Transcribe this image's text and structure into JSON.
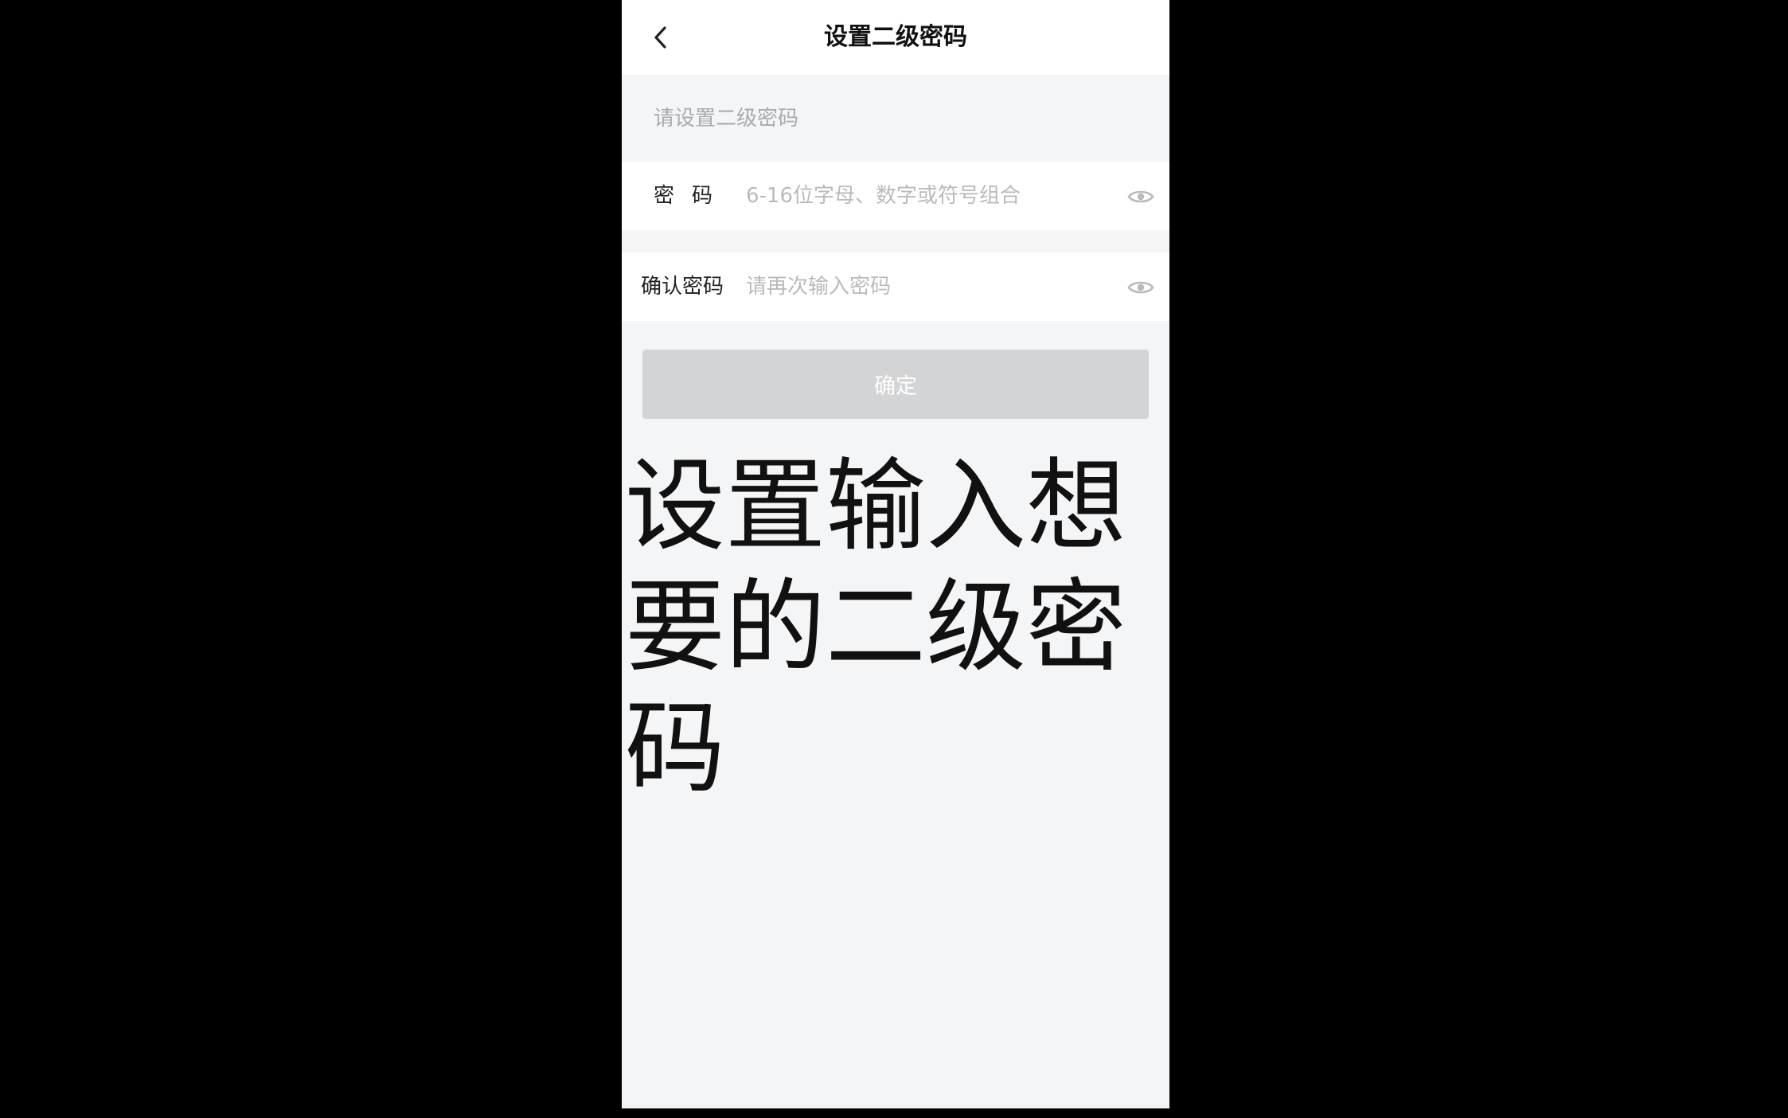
{
  "header": {
    "title": "设置二级密码",
    "back_icon": "chevron-left-icon"
  },
  "form": {
    "section_hint": "请设置二级密码",
    "password": {
      "label": "密码",
      "placeholder": "6-16位字母、数字或符号组合",
      "value": "",
      "toggle_icon": "eye-icon"
    },
    "confirm_password": {
      "label": "确认密码",
      "placeholder": "请再次输入密码",
      "value": "",
      "toggle_icon": "eye-icon"
    },
    "submit_label": "确定"
  },
  "caption": "设置输入想要的二级密码",
  "colors": {
    "background": "#f4f5f7",
    "button_disabled": "#d3d4d6",
    "placeholder": "#b8babe"
  }
}
